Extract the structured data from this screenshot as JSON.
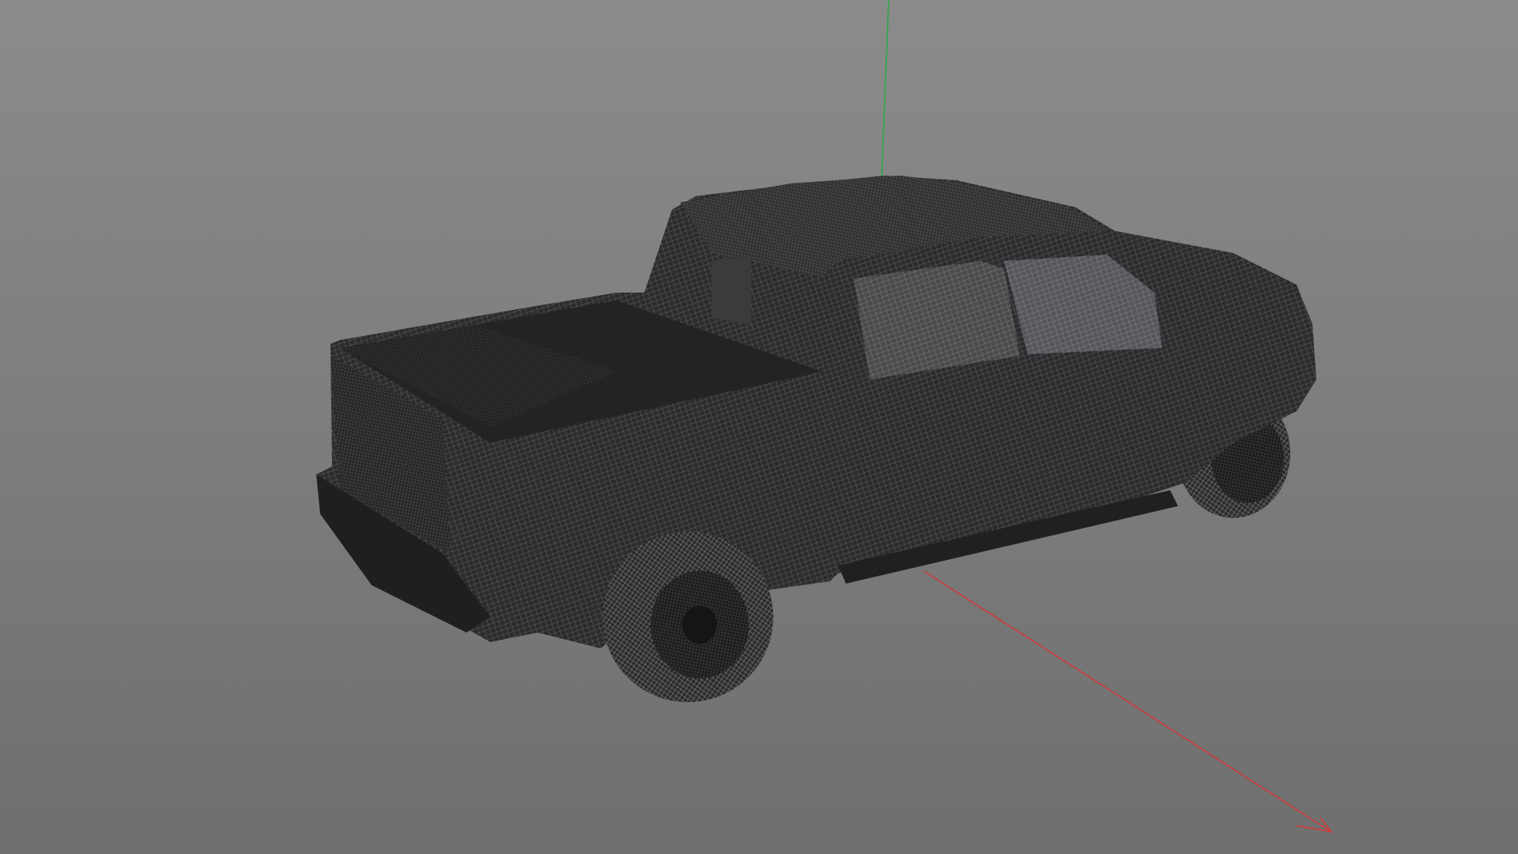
{
  "viewport": {
    "background_top": "#8b8b8b",
    "background_bottom": "#6f6f6f",
    "model": {
      "name": "pickup-truck-wireframe",
      "shade_color": "#2b2c2e",
      "wire_color": "#ffffff"
    },
    "axes": {
      "x_color": "#d23a3a",
      "y_color": "#2fa84a"
    }
  }
}
